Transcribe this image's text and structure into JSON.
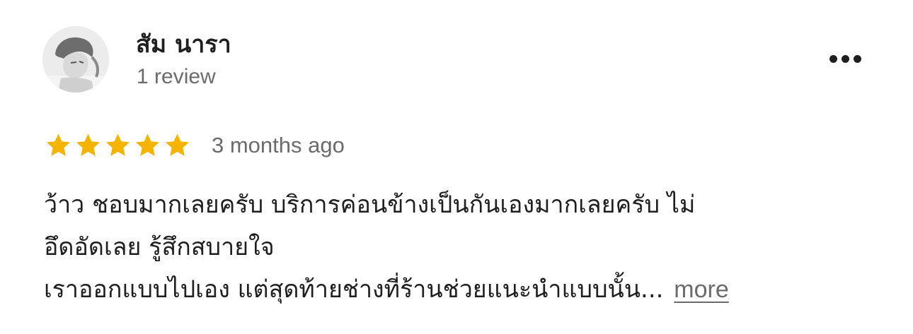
{
  "reviewer": {
    "name": "สัม นารา",
    "meta": "1 review"
  },
  "review": {
    "rating": 5,
    "rating_max": 5,
    "date": "3 months ago",
    "lines": [
      "ว้าว  ชอบมากเลยครับ บริการค่อนข้างเป็นกันเองมากเลยครับ ไม่",
      "อึดอัดเลย รู้สึกสบายใจ",
      "เราออกแบบไปเอง แต่สุดท้ายช่างที่ร้านช่วยแนะนำแบบนั้น..."
    ],
    "more_label": "more"
  },
  "icons": {
    "star": "star-icon",
    "more": "more-options-icon"
  },
  "colors": {
    "star": "#F4B400",
    "muted_text": "#6b6b6b",
    "primary_text": "#1f1f1f"
  }
}
